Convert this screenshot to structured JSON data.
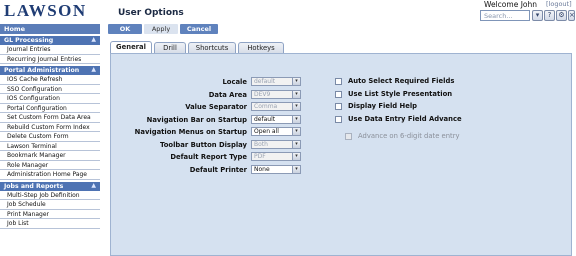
{
  "header": {
    "logo": "LAWSON",
    "page_title": "User Options",
    "welcome": "Welcome John",
    "logout": "[logout]",
    "search_placeholder": "Search...",
    "icons": [
      "search-dropdown-icon",
      "help-icon",
      "settings-icon",
      "close-icon"
    ]
  },
  "home": "Home",
  "buttons": {
    "ok": "OK",
    "apply": "Apply",
    "cancel": "Cancel"
  },
  "sidebar": {
    "sections": [
      {
        "title": "GL Processing",
        "items": [
          "Journal Entries",
          "Recurring Journal Entries"
        ]
      },
      {
        "title": "Portal Administration",
        "items": [
          "IOS Cache Refresh",
          "SSO Configuration",
          "IOS Configuration",
          "Portal Configuration",
          "Set Custom Form Data Area",
          "Rebuild Custom Form Index",
          "Delete Custom Form",
          "Lawson Terminal",
          "Bookmark Manager",
          "Role Manager",
          "Administration Home Page"
        ]
      },
      {
        "title": "Jobs and Reports",
        "items": [
          "Multi-Step Job Definition",
          "Job Schedule",
          "Print Manager",
          "Job List"
        ]
      }
    ]
  },
  "tabs": [
    "General",
    "Drill",
    "Shortcuts",
    "Hotkeys"
  ],
  "active_tab": "General",
  "fields": [
    {
      "label": "Locale",
      "value": "default",
      "disabled": true
    },
    {
      "label": "Data Area",
      "value": "DEV9",
      "disabled": true
    },
    {
      "label": "Value Separator",
      "value": "Comma",
      "disabled": true
    },
    {
      "label": "Navigation Bar on Startup",
      "value": "default",
      "disabled": false
    },
    {
      "label": "Navigation Menus on Startup",
      "value": "Open all",
      "disabled": false
    },
    {
      "label": "Toolbar Button Display",
      "value": "Both",
      "disabled": true
    },
    {
      "label": "Default Report Type",
      "value": "PDF",
      "disabled": true
    },
    {
      "label": "Default Printer",
      "value": "None",
      "disabled": false
    }
  ],
  "checkboxes": [
    {
      "label": "Auto Select Required Fields",
      "checked": false,
      "disabled": false
    },
    {
      "label": "Use List Style Presentation",
      "checked": false,
      "disabled": false
    },
    {
      "label": "Display Field Help",
      "checked": false,
      "disabled": false
    },
    {
      "label": "Use Data Entry Field Advance",
      "checked": false,
      "disabled": false
    },
    {
      "label": "Advance on 6-digit date entry",
      "checked": false,
      "disabled": true
    }
  ],
  "colors": {
    "accent": "#4e73b3",
    "panel": "#d5e1f0",
    "brand": "#1f3c74"
  }
}
